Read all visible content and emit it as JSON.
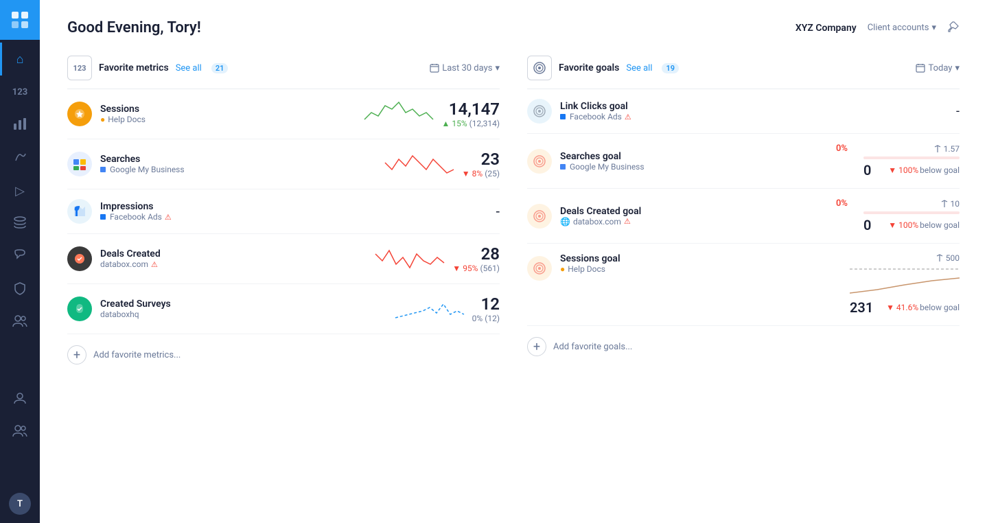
{
  "header": {
    "greeting": "Good Evening, Tory!",
    "company": "XYZ Company",
    "client_accounts": "Client accounts",
    "chevron": "▾"
  },
  "left_section": {
    "icon": "123",
    "title": "Favorite metrics",
    "see_all": "See all",
    "count": "21",
    "date_filter": "Last 30 days",
    "metrics": [
      {
        "id": "sessions",
        "name": "Sessions",
        "source": "Help Docs",
        "source_icon": "orange",
        "value": "14,147",
        "change_pct": "15%",
        "change_val": "(12,314)",
        "direction": "up",
        "chart_color": "#4caf50"
      },
      {
        "id": "searches",
        "name": "Searches",
        "source": "Google My Business",
        "source_icon": "blue",
        "value": "23",
        "change_pct": "8%",
        "change_val": "(25)",
        "direction": "down",
        "chart_color": "#f44336"
      },
      {
        "id": "impressions",
        "name": "Impressions",
        "source": "Facebook Ads",
        "source_icon": "blue-fb",
        "value": "-",
        "change_pct": "",
        "change_val": "",
        "direction": "none",
        "chart_color": "#999",
        "warning": true
      },
      {
        "id": "deals",
        "name": "Deals Created",
        "source": "databox.com",
        "source_icon": "dark",
        "value": "28",
        "change_pct": "95%",
        "change_val": "(561)",
        "direction": "down",
        "chart_color": "#f44336",
        "warning": true
      },
      {
        "id": "surveys",
        "name": "Created Surveys",
        "source": "databoxhq",
        "source_icon": "green",
        "value": "12",
        "change_pct": "0%",
        "change_val": "(12)",
        "direction": "neutral",
        "chart_color": "#2196f3"
      }
    ],
    "add_label": "Add favorite metrics..."
  },
  "right_section": {
    "icon": "◎",
    "title": "Favorite goals",
    "see_all": "See all",
    "count": "19",
    "date_filter": "Today",
    "goals": [
      {
        "id": "link-clicks",
        "name": "Link Clicks goal",
        "source": "Facebook Ads",
        "source_color": "blue-fb",
        "value": "-",
        "warning": true,
        "has_stats": false
      },
      {
        "id": "searches-goal",
        "name": "Searches goal",
        "source": "Google My Business",
        "source_color": "blue",
        "percent": "0%",
        "target": "1.57",
        "current": "0",
        "below": "100%",
        "has_stats": true
      },
      {
        "id": "deals-goal",
        "name": "Deals Created goal",
        "source": "databox.com",
        "source_color": "dark",
        "percent": "0%",
        "target": "10",
        "current": "0",
        "below": "100%",
        "has_stats": true,
        "warning": true
      },
      {
        "id": "sessions-goal",
        "name": "Sessions goal",
        "source": "Help Docs",
        "source_color": "orange",
        "percent": "",
        "target": "500",
        "current": "231",
        "below": "41.6%",
        "has_stats": true,
        "has_chart": true
      }
    ],
    "add_label": "Add favorite goals..."
  },
  "sidebar": {
    "items": [
      {
        "id": "dashboard",
        "icon": "⌂",
        "active": true
      },
      {
        "id": "metrics",
        "icon": "123"
      },
      {
        "id": "charts",
        "icon": "▦"
      },
      {
        "id": "goals",
        "icon": "♪"
      },
      {
        "id": "videos",
        "icon": "▷"
      },
      {
        "id": "layers",
        "icon": "≡"
      },
      {
        "id": "messages",
        "icon": "◯"
      },
      {
        "id": "shield",
        "icon": "⬡"
      },
      {
        "id": "team",
        "icon": "👥"
      },
      {
        "id": "user",
        "icon": "👤"
      },
      {
        "id": "team2",
        "icon": "👥"
      }
    ],
    "avatar": "T"
  }
}
